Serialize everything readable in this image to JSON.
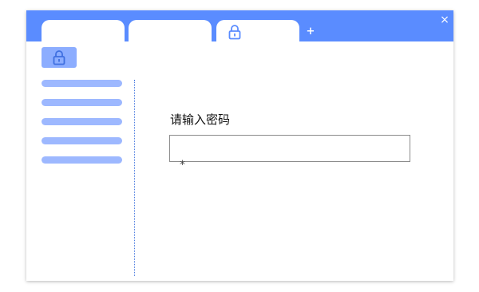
{
  "tabs": [
    {
      "label": ""
    },
    {
      "label": ""
    },
    {
      "label": "",
      "icon": "lock-icon"
    }
  ],
  "new_tab_label": "+",
  "close_label": "×",
  "toolbar": {
    "icon": "lock-icon"
  },
  "sidebar": {
    "items": [
      {
        "label": ""
      },
      {
        "label": ""
      },
      {
        "label": ""
      },
      {
        "label": ""
      },
      {
        "label": ""
      }
    ]
  },
  "form": {
    "password_label": "请输入密码",
    "password_value": "",
    "password_mask": "*"
  },
  "colors": {
    "accent": "#5a8cff",
    "accent_light": "#8cadff",
    "sidebar_bar": "#9db8ff",
    "input_border": "#8c8c8c"
  }
}
